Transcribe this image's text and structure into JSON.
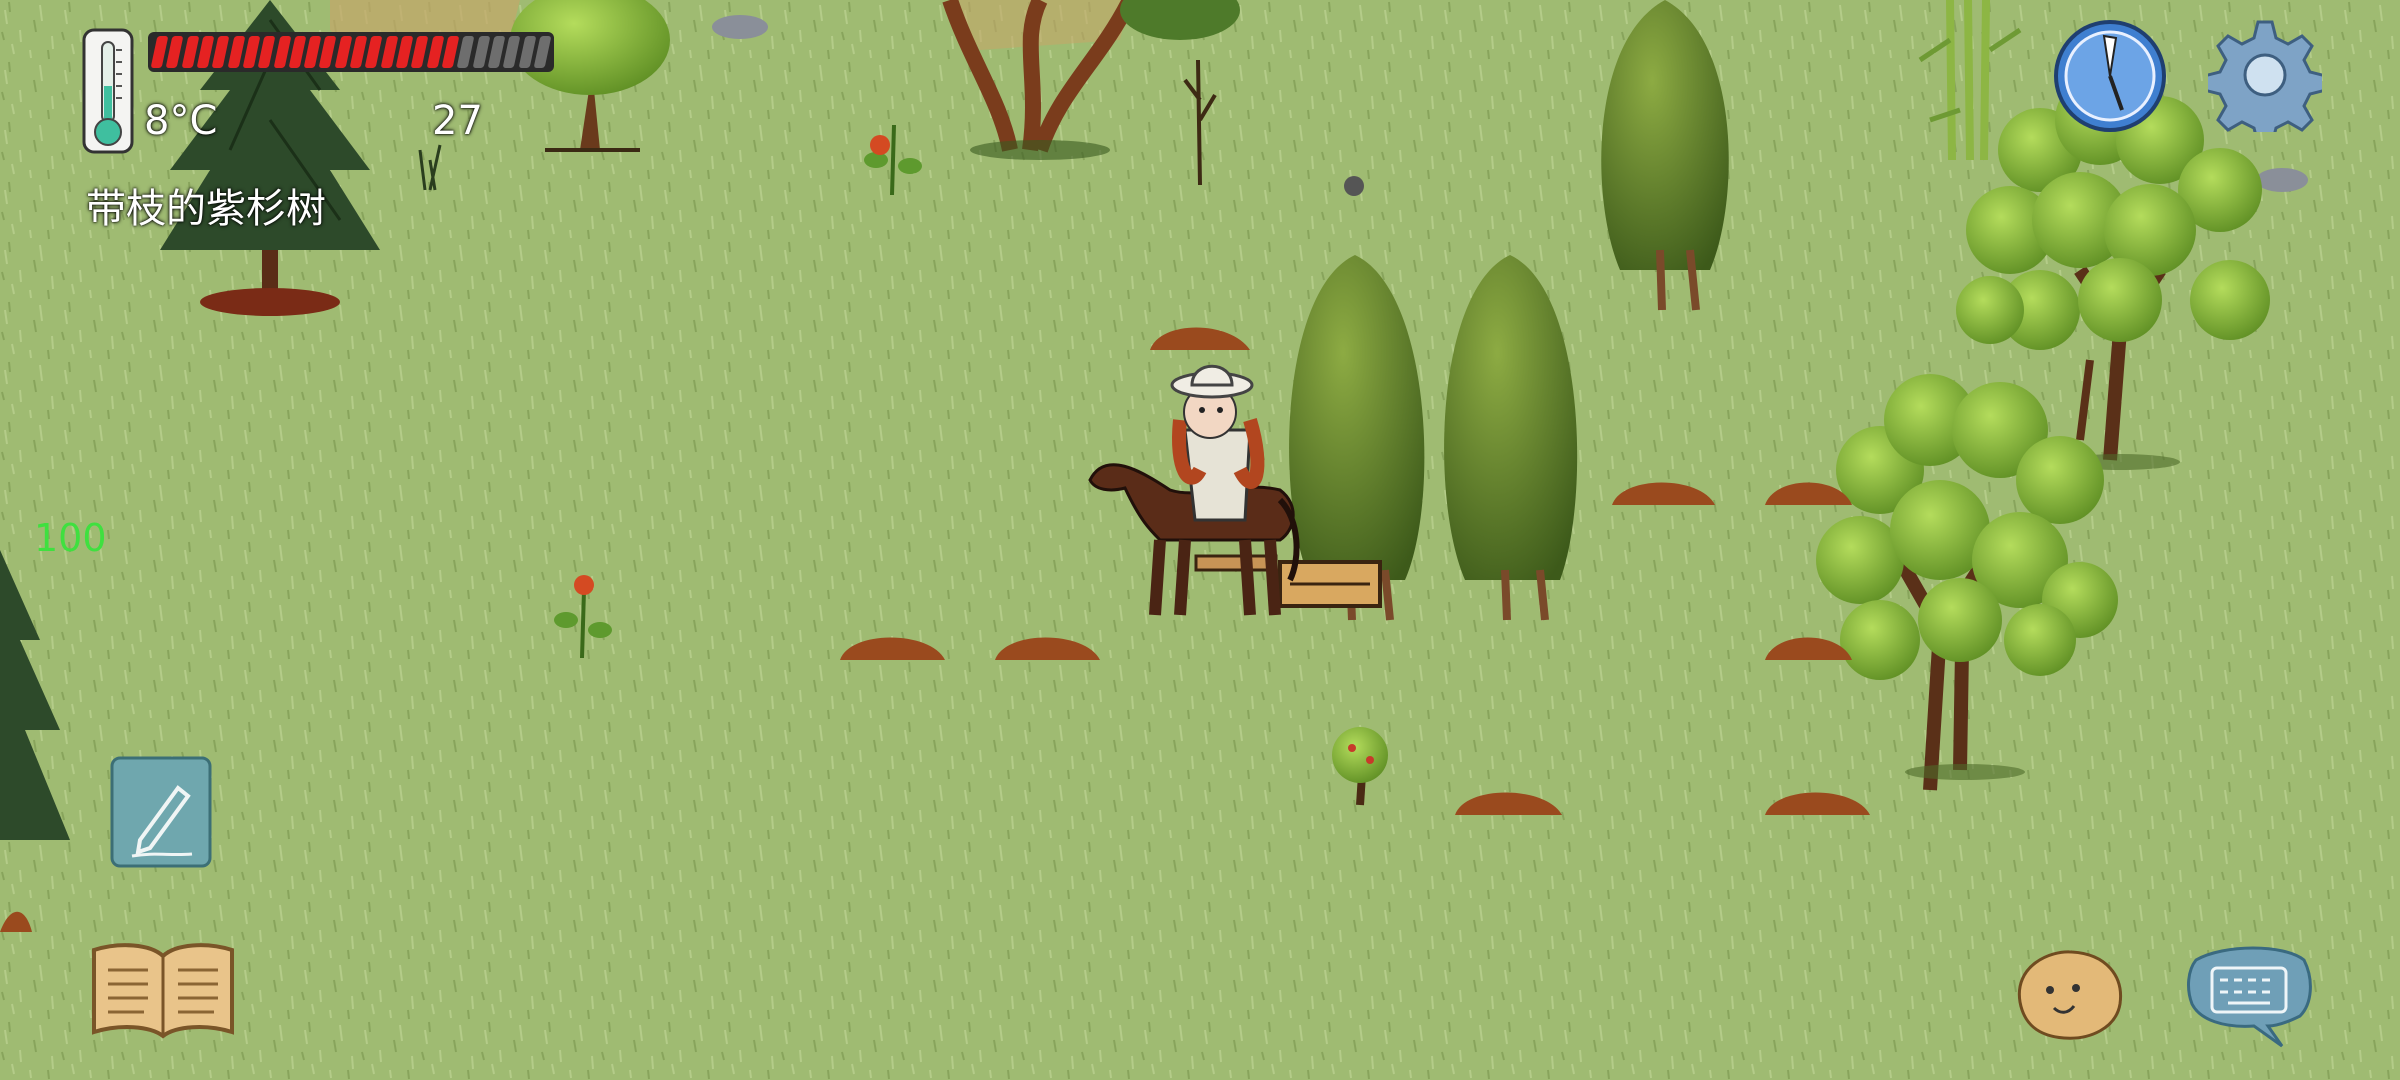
{
  "hud": {
    "temperature": "8°C",
    "age": "27",
    "hover_label": "带枝的紫杉树",
    "debug_value": "100",
    "food": {
      "filled": 20,
      "total": 26,
      "filled_color": "#e52222",
      "empty_color": "#6e6e6e"
    }
  },
  "colors": {
    "grass": "#9bb86e",
    "dirt": "#9a4a1e",
    "horse": "#5a2c18",
    "tree_dark": "#4d6b22",
    "tree_light": "#86b83a"
  },
  "icons": [
    "thermometer-icon",
    "compass-icon",
    "settings-gear-icon",
    "pencil-icon",
    "recipe-book-icon",
    "emote-face-icon",
    "keyboard-chat-icon"
  ]
}
